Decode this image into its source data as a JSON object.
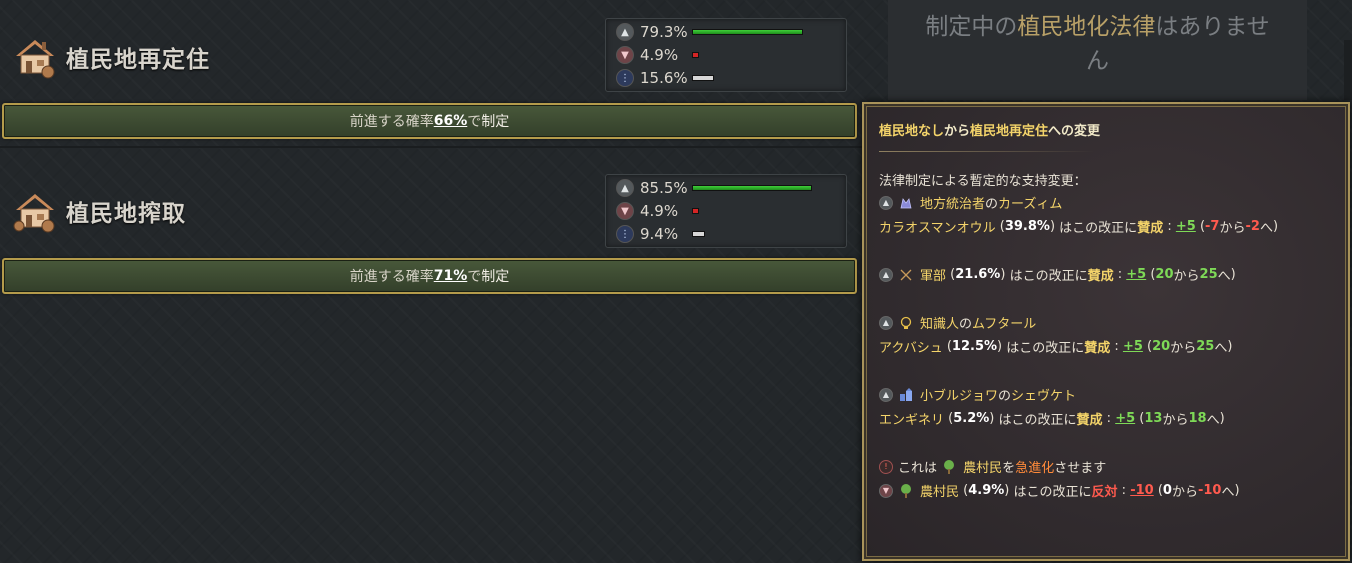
{
  "laws": [
    {
      "title": "植民地再定住",
      "support": {
        "approve": "79.3%",
        "oppose": "4.9%",
        "neutral": "15.6%"
      },
      "approve_fill": 0.793,
      "oppose_fill": 0.049,
      "neutral_fill": 0.156,
      "button": {
        "prefix": "前進する確率",
        "pct": "66%",
        "mid": "で",
        "action": "制定"
      }
    },
    {
      "title": "植民地搾取",
      "support": {
        "approve": "85.5%",
        "oppose": "4.9%",
        "neutral": "9.4%"
      },
      "approve_fill": 0.855,
      "oppose_fill": 0.049,
      "neutral_fill": 0.094,
      "button": {
        "prefix": "前進する確率",
        "pct": "71%",
        "mid": "で",
        "action": "制定"
      }
    }
  ],
  "banner": {
    "p1": "制定中の",
    "hl1": "植民地化法律",
    "p2": "はありませ",
    "p3": "ん"
  },
  "tooltip": {
    "title_hl1": "植民地なし",
    "title_mid": "から",
    "title_hl2": "植民地再定住",
    "title_end": "への変更",
    "section": "法律制定による暫定的な支持変更：",
    "groups": [
      {
        "line1_name": "地方統治者",
        "line1_of": "の",
        "line1_leader": "カーズィム",
        "line2_leader": "カラオスマンオウル",
        "pct": "39.8%",
        "stance_pre": "はこの改正に",
        "stance": "賛成",
        "delta": "+5",
        "from": "-7",
        "from_word": "から",
        "to": "-2",
        "to_word": "へ"
      },
      {
        "name": "軍部",
        "pct": "21.6%",
        "stance_pre": "はこの改正に",
        "stance": "賛成",
        "delta": "+5",
        "from": "20",
        "from_word": "から",
        "to": "25",
        "to_word": "へ"
      },
      {
        "line1_name": "知識人",
        "line1_of": "の",
        "line1_leader": "ムフタール",
        "line2_leader": "アクバシュ",
        "pct": "12.5%",
        "stance_pre": "はこの改正に",
        "stance": "賛成",
        "delta": "+5",
        "from": "20",
        "from_word": "から",
        "to": "25",
        "to_word": "へ"
      },
      {
        "line1_name": "小ブルジョワ",
        "line1_of": "の",
        "line1_leader": "シェヴケト",
        "line2_leader": "エンギネリ",
        "pct": "5.2%",
        "stance_pre": "はこの改正に",
        "stance": "賛成",
        "delta": "+5",
        "from": "13",
        "from_word": "から",
        "to": "18",
        "to_word": "へ"
      }
    ],
    "radical": {
      "pre": "これは",
      "group": "農村民",
      "mid": "を",
      "word": "急進化",
      "post": "させます"
    },
    "farmers": {
      "name": "農村民",
      "pct": "4.9%",
      "stance_pre": "はこの改正に",
      "stance": "反対",
      "delta": "-10",
      "from": "0",
      "from_word": "から",
      "to": "-10",
      "to_word": "へ"
    }
  },
  "colors": {
    "approve": "#2fb12b",
    "oppose": "#d42525",
    "neutral": "#d7d7d7",
    "accent_gold": "#b49b4b"
  },
  "icons": [
    "house-icon",
    "thumbs-up-icon",
    "thumbs-down-icon",
    "neutral-icon",
    "crown-icon",
    "swords-icon",
    "lightbulb-icon",
    "buildings-icon",
    "tree-icon",
    "warning-icon"
  ]
}
